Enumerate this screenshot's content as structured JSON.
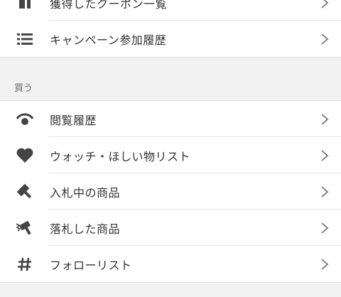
{
  "top_group": {
    "items": [
      {
        "label": "獲得したクーポン一覧",
        "icon": "coupon-icon"
      },
      {
        "label": "キャンペーン参加履歴",
        "icon": "list-icon"
      }
    ]
  },
  "buy_section": {
    "header": "買う",
    "items": [
      {
        "label": "閲覧履歴",
        "icon": "eye-icon"
      },
      {
        "label": "ウォッチ・ほしい物リスト",
        "icon": "heart-icon"
      },
      {
        "label": "入札中の商品",
        "icon": "gavel-icon"
      },
      {
        "label": "落札した商品",
        "icon": "gavel-struck-icon"
      },
      {
        "label": "フォローリスト",
        "icon": "hash-icon"
      }
    ]
  },
  "chevron_icon": "chevron-right-icon",
  "colors": {
    "icon": "#444444",
    "chevron": "#777777",
    "background": "#f2f2f2",
    "row": "#ffffff",
    "separator": "#e5e5e5"
  }
}
